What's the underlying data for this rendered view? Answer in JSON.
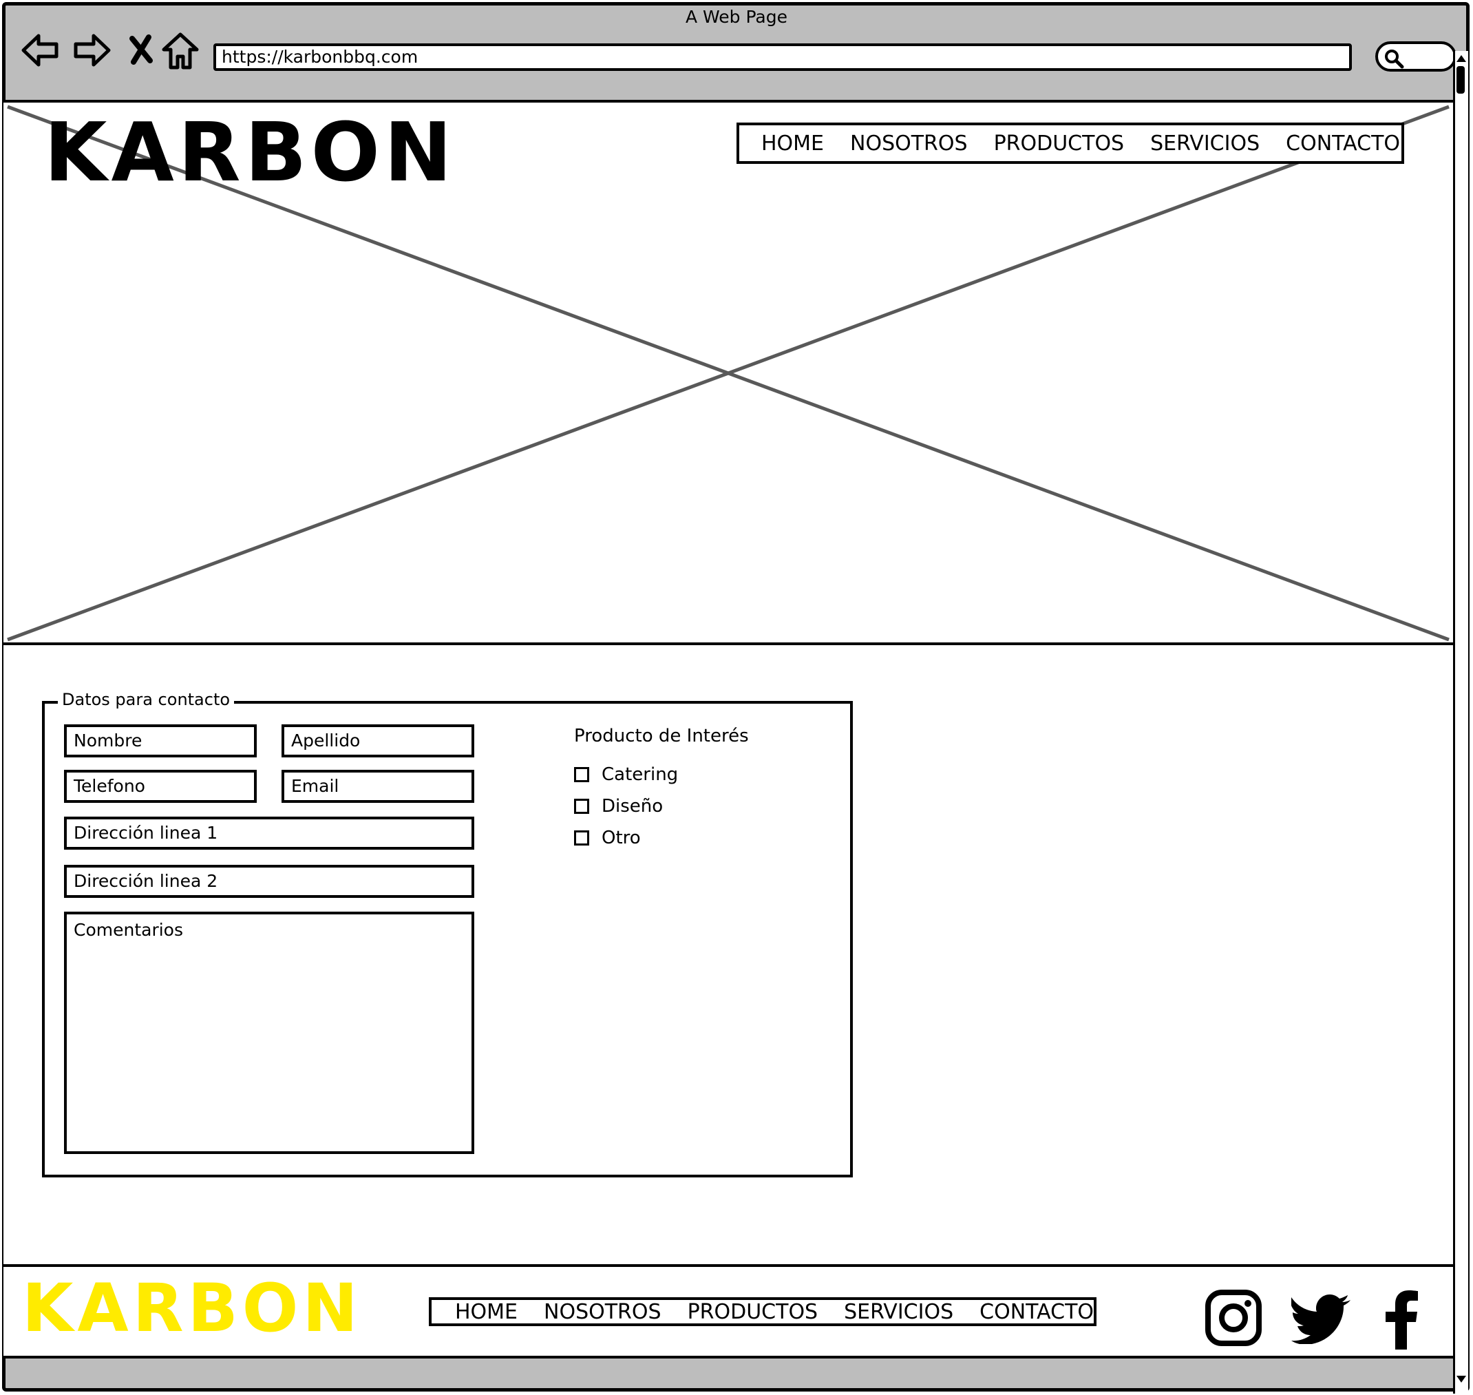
{
  "window": {
    "title": "A Web Page"
  },
  "browser": {
    "url": "https://karbonbbq.com",
    "nav_icons": [
      "back-arrow-icon",
      "forward-arrow-icon",
      "close-icon",
      "home-icon"
    ],
    "search_icon": "search-icon"
  },
  "header": {
    "logo_text": "KARBON",
    "nav": [
      "HOME",
      "NOSOTROS",
      "PRODUCTOS",
      "SERVICIOS",
      "CONTACTO"
    ]
  },
  "form": {
    "legend": "Datos para contacto",
    "fields": {
      "nombre": "Nombre",
      "apellido": "Apellido",
      "telefono": "Telefono",
      "email": "Email",
      "direccion1": "Dirección linea 1",
      "direccion2": "Dirección linea 2",
      "comentarios": "Comentarios"
    },
    "interest": {
      "title": "Producto de Interés",
      "options": [
        "Catering",
        "Diseño",
        "Otro"
      ]
    }
  },
  "footer": {
    "logo_text": "KARBON",
    "logo_color": "#ffeb00",
    "nav": [
      "HOME",
      "NOSOTROS",
      "PRODUCTOS",
      "SERVICIOS",
      "CONTACTO"
    ],
    "social": [
      "instagram-icon",
      "twitter-icon",
      "facebook-icon"
    ]
  }
}
